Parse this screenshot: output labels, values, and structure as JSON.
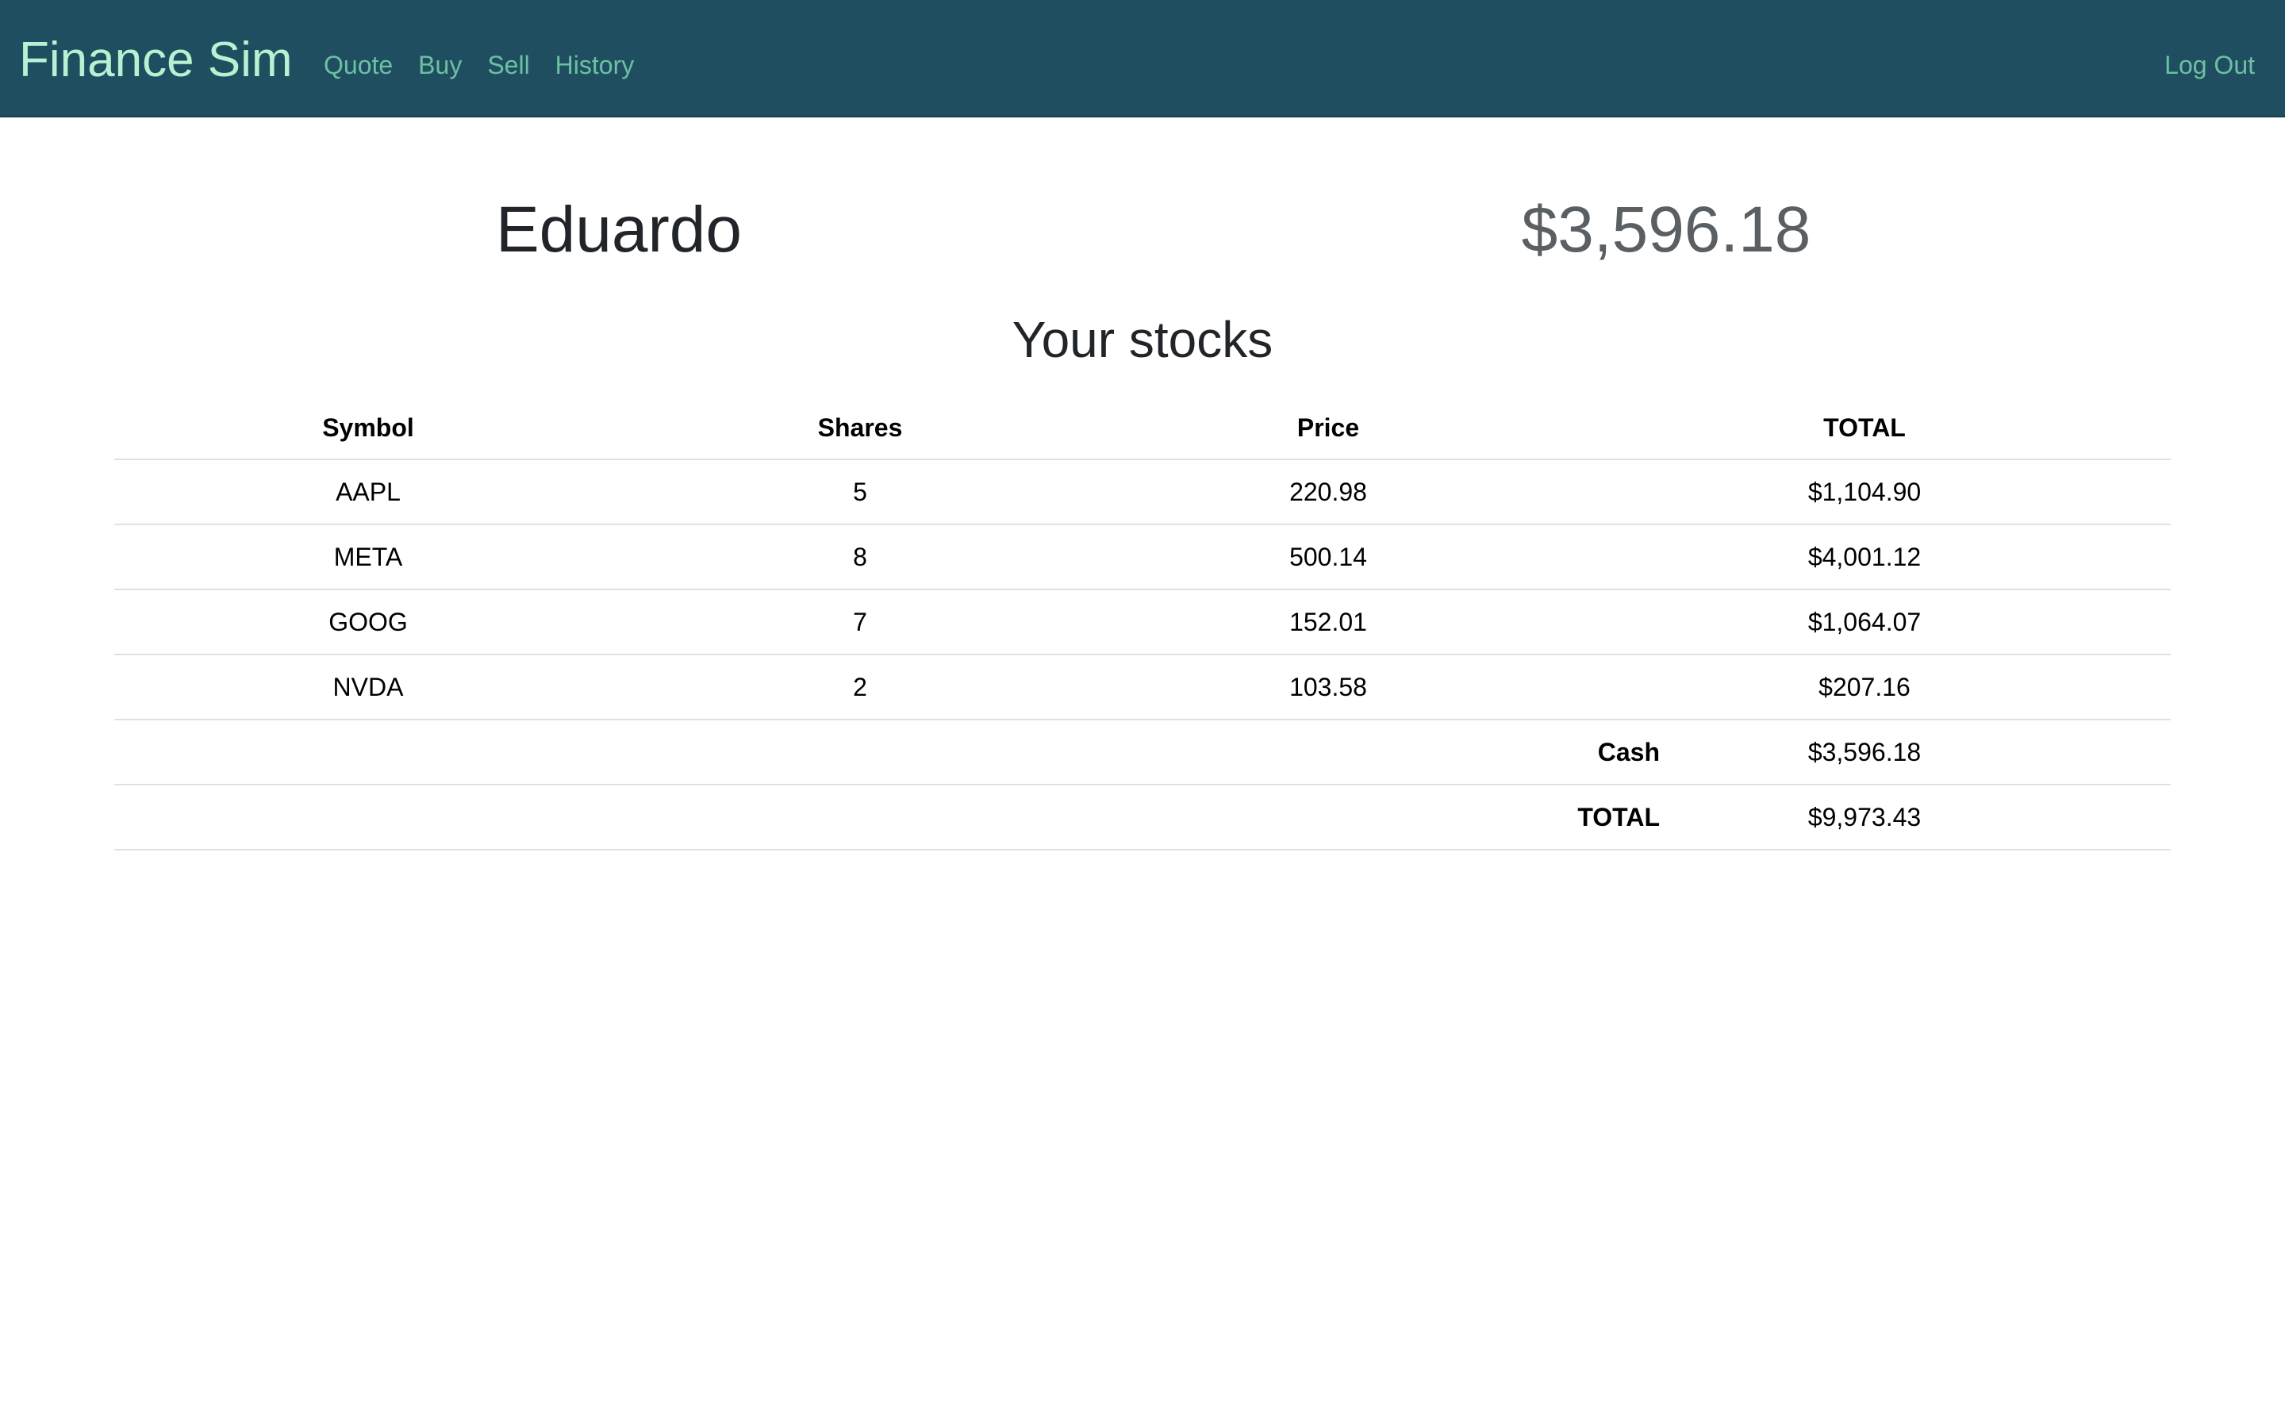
{
  "navbar": {
    "brand": "Finance Sim",
    "links": [
      "Quote",
      "Buy",
      "Sell",
      "History"
    ],
    "logout": "Log Out"
  },
  "header": {
    "username": "Eduardo",
    "cash": "$3,596.18"
  },
  "section_title": "Your stocks",
  "table": {
    "columns": [
      "Symbol",
      "Shares",
      "Price",
      "TOTAL"
    ],
    "rows": [
      {
        "symbol": "AAPL",
        "shares": "5",
        "price": "220.98",
        "total": "$1,104.90"
      },
      {
        "symbol": "META",
        "shares": "8",
        "price": "500.14",
        "total": "$4,001.12"
      },
      {
        "symbol": "GOOG",
        "shares": "7",
        "price": "152.01",
        "total": "$1,064.07"
      },
      {
        "symbol": "NVDA",
        "shares": "2",
        "price": "103.58",
        "total": "$207.16"
      }
    ],
    "cash_label": "Cash",
    "cash_value": "$3,596.18",
    "total_label": "TOTAL",
    "total_value": "$9,973.43"
  }
}
